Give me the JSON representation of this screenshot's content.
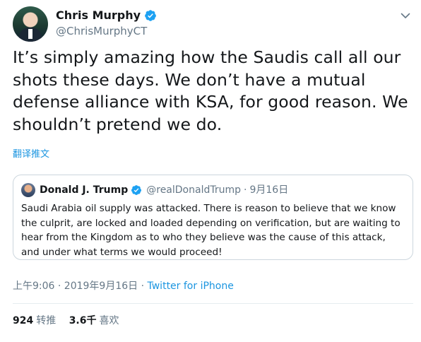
{
  "author": {
    "display_name": "Chris Murphy",
    "handle": "@ChrisMurphyCT",
    "verified": true
  },
  "tweet": {
    "text": "It’s simply amazing how the Saudis call all our shots these days. We don’t have a mutual defense alliance with KSA, for good reason. We shouldn’t pretend we do.",
    "translate_label": "翻译推文"
  },
  "quoted_tweet": {
    "display_name": "Donald J. Trump",
    "handle": "@realDonaldTrump",
    "separator": "·",
    "date": "9月16日",
    "verified": true,
    "text": "Saudi Arabia oil supply was attacked. There is reason to believe that we know the culprit, are locked and loaded depending on verification, but are waiting to hear from the Kingdom as to who they believe was the cause of this attack, and under what terms we would proceed!"
  },
  "meta": {
    "timestamp": "上午9:06 · 2019年9月16日 · ",
    "source": "Twitter for iPhone"
  },
  "stats": {
    "retweets_count": "924",
    "retweets_label": "转推",
    "likes_count": "3.6千",
    "likes_label": "喜欢"
  },
  "colors": {
    "link": "#1b95e0",
    "verified": "#1da1f2",
    "secondary_text": "#657786",
    "border": "#ccd6dd"
  },
  "icons": {
    "verified": "verified-badge-icon",
    "caret": "chevron-down-icon"
  }
}
